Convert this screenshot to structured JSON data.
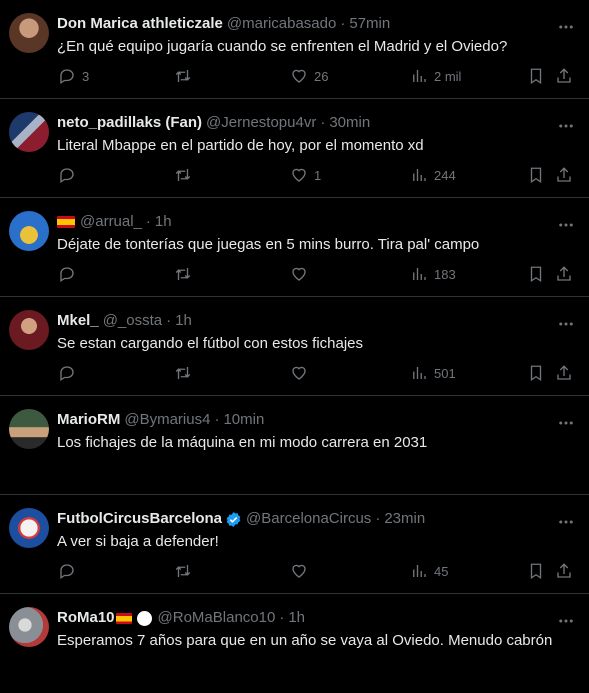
{
  "tweets": [
    {
      "name": "Don Marica athleticzale",
      "handle": "@maricabasado",
      "time": "57min",
      "text": "¿En qué equipo jugaría cuando se enfrenten el Madrid y el Oviedo?",
      "replies": "3",
      "retweets": "",
      "likes": "26",
      "views": "2 mil",
      "avatar_color": "#7a4a3a"
    },
    {
      "name": "neto_padillaks (Fan)",
      "handle": "@Jernestopu4vr",
      "time": "30min",
      "text": "Literal Mbappe en el partido de hoy, por el momento xd",
      "replies": "",
      "retweets": "",
      "likes": "1",
      "views": "244",
      "avatar_color": "#1e3a6b"
    },
    {
      "name": "",
      "handle": "@arrual_",
      "time": "1h",
      "text": "Déjate de tonterías que juegas en 5 mins burro. Tira pal' campo",
      "replies": "",
      "retweets": "",
      "likes": "",
      "views": "183",
      "avatar_color": "#2a6fc9"
    },
    {
      "name": "Mkel_",
      "handle": "@_ossta",
      "time": "1h",
      "text": "Se estan cargando el fútbol con estos fichajes",
      "replies": "",
      "retweets": "",
      "likes": "",
      "views": "501",
      "avatar_color": "#6b1a22"
    },
    {
      "name": "MarioRM",
      "handle": "@Bymarius4",
      "time": "10min",
      "text": "Los fichajes de la máquina en mi modo carrera en 2031",
      "replies": "",
      "retweets": "",
      "likes": "",
      "views": "",
      "avatar_color": "#3d5a40"
    },
    {
      "name": "FutbolCircusBarcelona",
      "handle": "@BarcelonaCircus",
      "time": "23min",
      "text": "A ver si baja a defender!",
      "replies": "",
      "retweets": "",
      "likes": "",
      "views": "45",
      "avatar_color": "#1d4fa0"
    },
    {
      "name": "RoMa10",
      "handle": "@RoMaBlanco10",
      "time": "1h",
      "text": "Esperamos 7 años para que en un año se vaya al Oviedo. Menudo cabrón",
      "replies": "",
      "retweets": "",
      "likes": "",
      "views": "",
      "avatar_color": "#8a8f96"
    }
  ],
  "colors": {
    "background": "#000000",
    "text": "#e7e9ea",
    "muted": "#71767b",
    "divider": "#2f3336",
    "verified": "#1d9bf0"
  }
}
